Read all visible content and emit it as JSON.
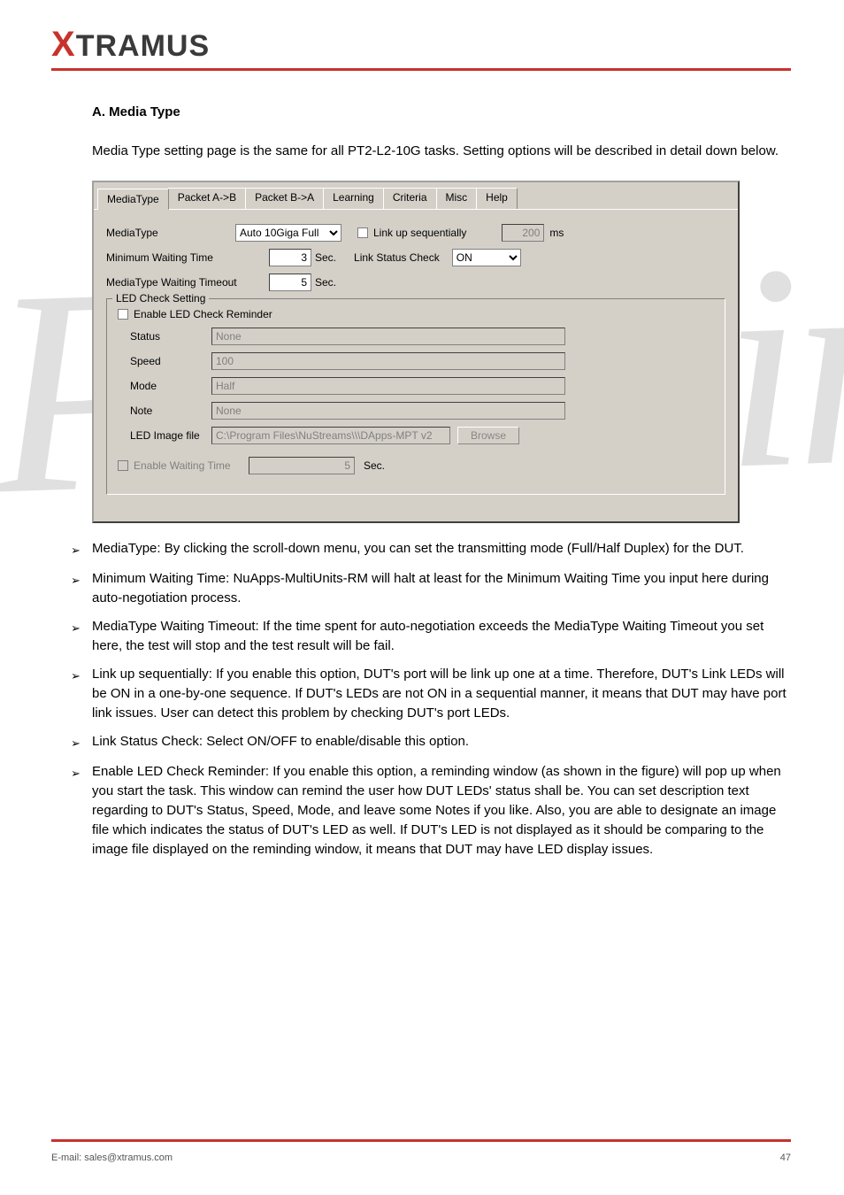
{
  "logo_main": "TRAMUS",
  "section_title": "A. Media Type",
  "section_desc": "Media Type setting page is the same for all PT2-L2-10G tasks. Setting options will be described in detail down below.",
  "tabs": [
    "MediaType",
    "Packet A->B",
    "Packet B->A",
    "Learning",
    "Criteria",
    "Misc",
    "Help"
  ],
  "form": {
    "mediatype_lbl": "MediaType",
    "mediatype_val": "Auto 10Giga Full",
    "linkup_lbl": "Link up sequentially",
    "linkup_ms_val": "200",
    "ms_lbl": "ms",
    "minwait_lbl": "Minimum Waiting Time",
    "minwait_val": "3",
    "sec_lbl": "Sec.",
    "linkstatus_lbl": "Link Status Check",
    "linkstatus_val": "ON",
    "timeout_lbl": "MediaType Waiting Timeout",
    "timeout_val": "5"
  },
  "led": {
    "legend": "LED Check Setting",
    "enable_lbl": "Enable LED Check Reminder",
    "status_lbl": "Status",
    "status_val": "None",
    "speed_lbl": "Speed",
    "speed_val": "100",
    "mode_lbl": "Mode",
    "mode_val": "Half",
    "note_lbl": "Note",
    "note_val": "None",
    "imgfile_lbl": "LED Image file",
    "imgfile_val": "C:\\Program Files\\NuStreams\\\\\\DApps-MPT v2",
    "browse_btn": "Browse",
    "waittime_lbl": "Enable Waiting Time",
    "waittime_val": "5"
  },
  "bullets": [
    "MediaType: By clicking the scroll-down menu, you can set the transmitting mode (Full/Half Duplex) for the DUT.",
    "Minimum Waiting Time: NuApps-MultiUnits-RM will halt at least for the Minimum Waiting Time you input here during auto-negotiation process.",
    "MediaType Waiting Timeout: If the time spent for auto-negotiation exceeds the MediaType Waiting Timeout you set here, the test will stop and the test result will be fail.",
    "Link up sequentially: If you enable this option, DUT's port will be link up one at a time. Therefore, DUT's Link LEDs will be ON in a one-by-one sequence. If DUT's LEDs are not ON in a sequential manner, it means that DUT may have port link issues. User can detect this problem by checking DUT's port LEDs.",
    "Link Status Check: Select ON/OFF to enable/disable this option.",
    "Enable LED Check Reminder: If you enable this option, a reminding window (as shown in the figure) will pop up when you start the task. This window can remind the user how DUT LEDs' status shall be. You can set description text regarding to DUT's Status, Speed, Mode, and leave some Notes if you like. Also, you are able to designate an image file which indicates the status of DUT's LED as well. If DUT's LED is not displayed as it should be comparing to the image file displayed on the reminding window, it means that DUT may have LED display issues."
  ],
  "footer_left": "E-mail: sales@xtramus.com",
  "footer_right": "47",
  "watermark": "Preliminary"
}
